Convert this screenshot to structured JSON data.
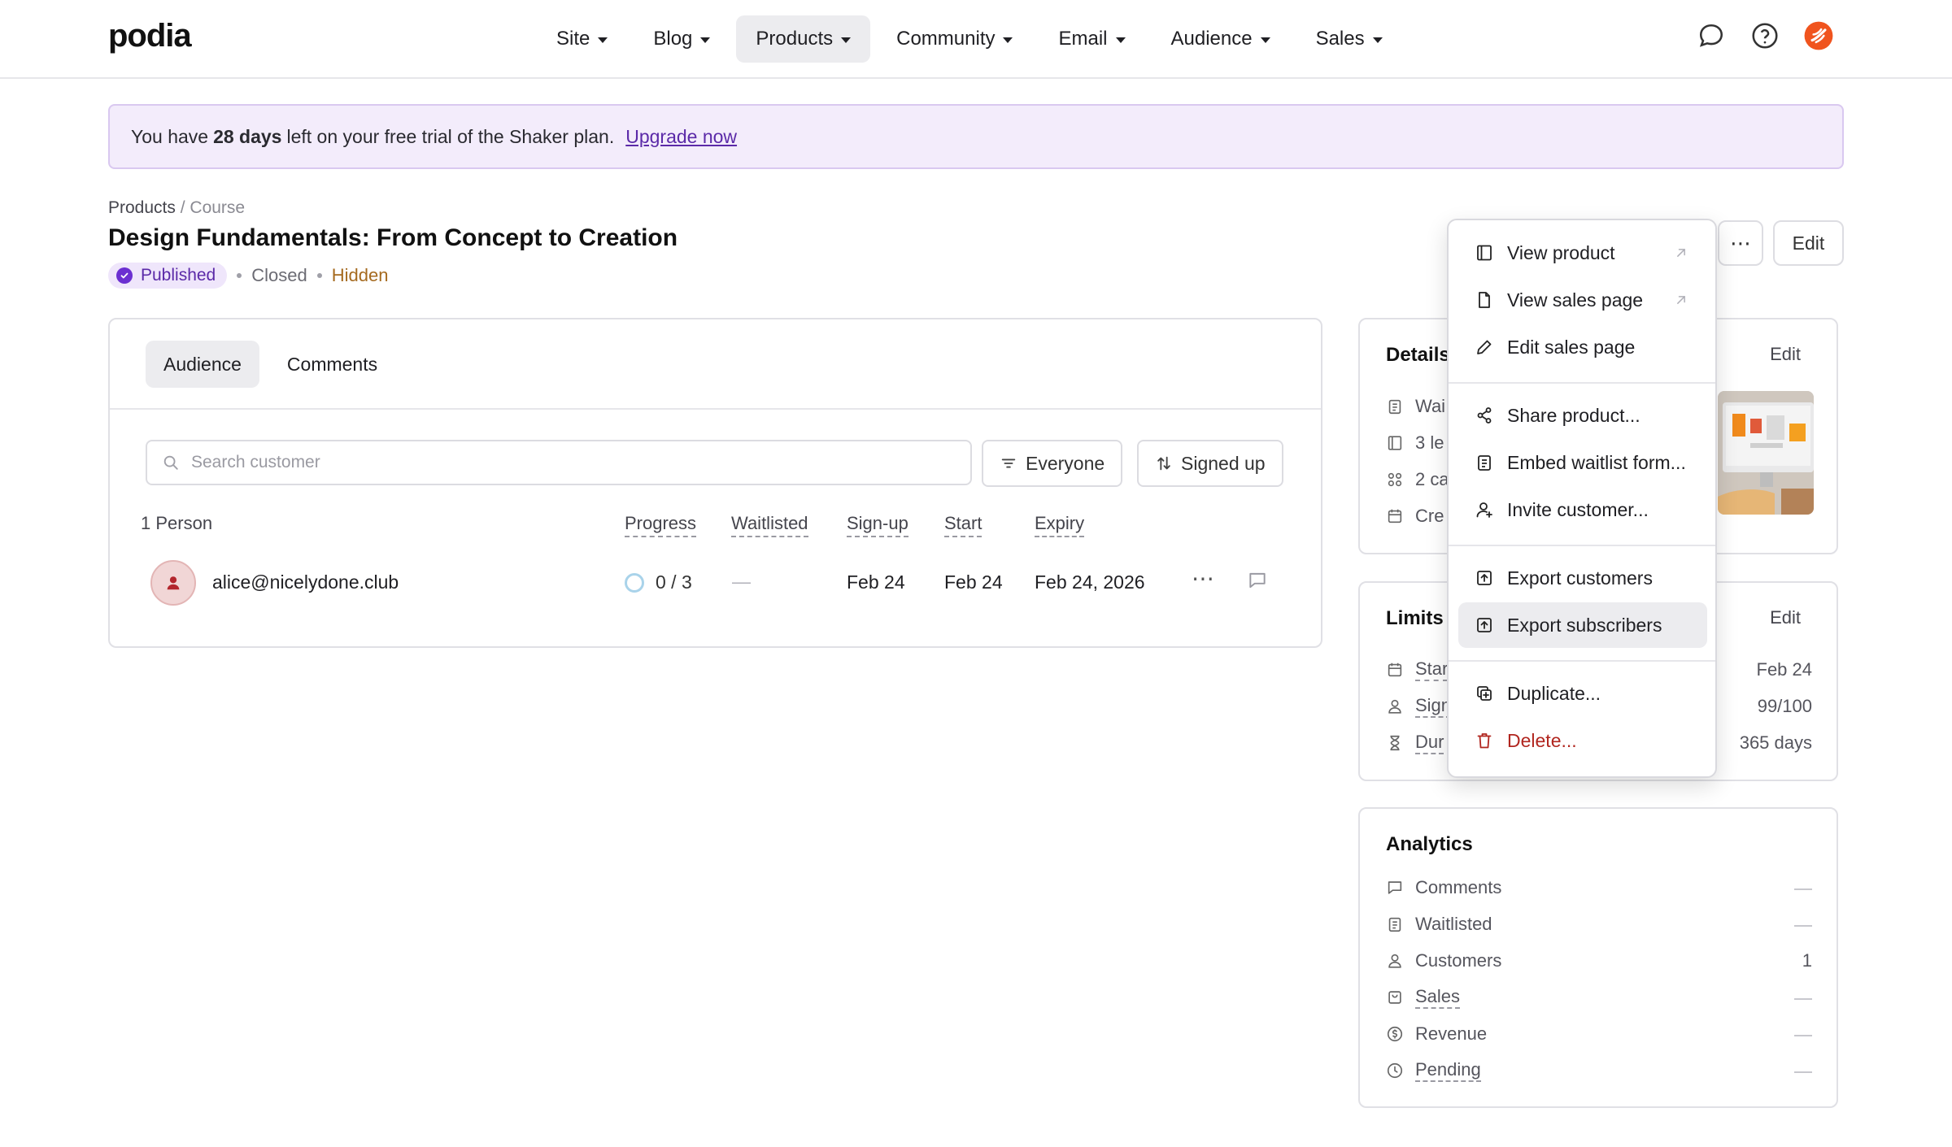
{
  "brand": {
    "logo": "podia"
  },
  "nav": {
    "items": [
      {
        "label": "Site"
      },
      {
        "label": "Blog"
      },
      {
        "label": "Products"
      },
      {
        "label": "Community"
      },
      {
        "label": "Email"
      },
      {
        "label": "Audience"
      },
      {
        "label": "Sales"
      }
    ],
    "active": "Products"
  },
  "banner": {
    "text_before": "You have",
    "days": "28 days",
    "text_after": "left on your free trial of the Shaker plan.",
    "link": "Upgrade now"
  },
  "breadcrumb": {
    "root": "Products",
    "separator": "/",
    "current": "Course"
  },
  "product": {
    "title": "Design Fundamentals: From Concept to Creation",
    "status": "Published",
    "availability": "Closed",
    "visibility": "Hidden"
  },
  "actions": {
    "more": "⋯",
    "edit": "Edit"
  },
  "tabs": [
    {
      "label": "Audience"
    },
    {
      "label": "Comments"
    }
  ],
  "filters": {
    "search_placeholder": "Search customer",
    "segment": "Everyone",
    "sort": "Signed up"
  },
  "table": {
    "count": "1 Person",
    "columns": [
      "Progress",
      "Waitlisted",
      "Sign-up",
      "Start",
      "Expiry"
    ],
    "rows": [
      {
        "email": "alice@nicelydone.club",
        "progress": "0 / 3",
        "waitlisted": "—",
        "signup": "Feb 24",
        "start": "Feb 24",
        "expiry": "Feb 24, 2026"
      }
    ]
  },
  "details_card": {
    "title": "Details",
    "edit": "Edit",
    "rows": [
      "Wai",
      "3 le",
      "2 ca",
      "Cre"
    ]
  },
  "limits_card": {
    "title": "Limits",
    "edit": "Edit",
    "rows": [
      {
        "label": "Star",
        "value": "Feb 24"
      },
      {
        "label": "Sign",
        "value": "99/100"
      },
      {
        "label": "Dur",
        "value": "365 days"
      }
    ]
  },
  "analytics_card": {
    "title": "Analytics",
    "rows": [
      {
        "label": "Comments",
        "value": "—"
      },
      {
        "label": "Waitlisted",
        "value": "—"
      },
      {
        "label": "Customers",
        "value": "1"
      },
      {
        "label": "Sales",
        "value": "—"
      },
      {
        "label": "Revenue",
        "value": "—"
      },
      {
        "label": "Pending",
        "value": "—"
      }
    ]
  },
  "menu": {
    "items": [
      {
        "label": "View product"
      },
      {
        "label": "View sales page"
      },
      {
        "label": "Edit sales page"
      },
      {
        "label": "Share product..."
      },
      {
        "label": "Embed waitlist form..."
      },
      {
        "label": "Invite customer..."
      },
      {
        "label": "Export customers"
      },
      {
        "label": "Export subscribers"
      },
      {
        "label": "Duplicate..."
      },
      {
        "label": "Delete..."
      }
    ],
    "highlighted": "Export subscribers"
  },
  "colors": {
    "accent": "#6b2fd1",
    "banner_bg": "#f3ecfb",
    "hidden": "#a56a1f",
    "danger": "#b1261f",
    "brand_icon": "#f0541e"
  }
}
